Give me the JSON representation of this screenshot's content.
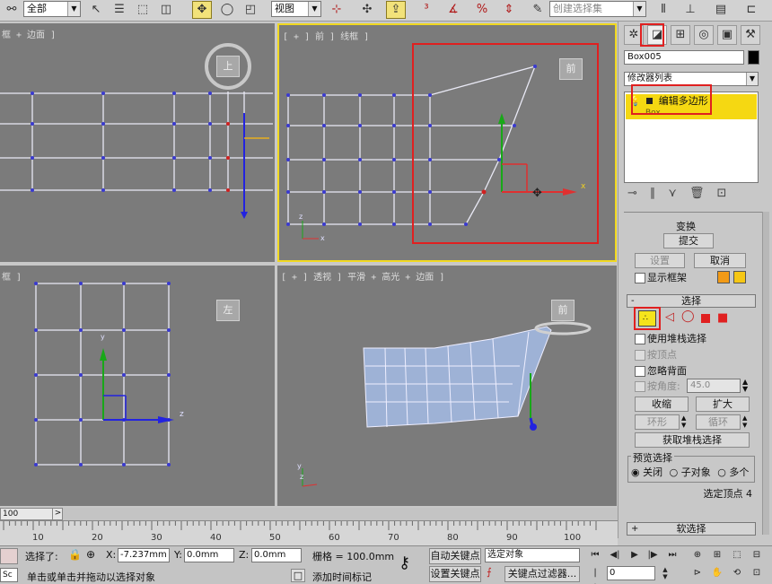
{
  "toolbar": {
    "selection_filter": "全部",
    "ref_coord": "视图",
    "named_selection": "创建选择集"
  },
  "viewports": {
    "top": {
      "label": "框 + 边面 ]",
      "cube": "上"
    },
    "front": {
      "label": "[ + ] 前 ] 线框 ]",
      "cube": "前",
      "axis_x": "x",
      "axis_z": "z",
      "gizmo_x": "x"
    },
    "left": {
      "label": "框 ]",
      "cube": "左",
      "axis_y": "y",
      "gizmo_z": "z"
    },
    "persp": {
      "label": "[ + ] 透视 ] 平滑 + 高光 + 边面 ]",
      "cube": "前",
      "axis_y": "y",
      "axis_z": "z"
    }
  },
  "command_panel": {
    "object_name": "Box005",
    "modifier_list": "修改器列表",
    "stack": [
      {
        "label": "编辑多边形",
        "selected": true
      },
      {
        "label": "Box",
        "selected": false
      }
    ],
    "rollout_top_label": "变换",
    "commit": "提交",
    "settings": "设置",
    "cancel": "取消",
    "show_cage": "显示框架",
    "selection_rollout": "选择",
    "use_stack_selection": "使用堆栈选择",
    "by_vertex": "按顶点",
    "ignore_backfacing": "忽略背面",
    "by_angle": "按角度:",
    "angle_value": "45.0",
    "shrink": "收缩",
    "grow": "扩大",
    "ring": "环形",
    "loop": "循环",
    "get_stack_selection": "获取堆栈选择",
    "preview_selection": "预览选择",
    "preview_off": "关闭",
    "preview_subobj": "子对象",
    "preview_multi": "多个",
    "selected_info": "选定顶点 4",
    "soft_selection": "软选择"
  },
  "timeline": {
    "slider": "100",
    "ticks": [
      "10",
      "20",
      "30",
      "40",
      "50",
      "60",
      "70",
      "80",
      "90",
      "100"
    ]
  },
  "status": {
    "selected_label": "选择了:",
    "x_label": "X:",
    "x_value": "-7.237mm",
    "y_label": "Y:",
    "y_value": "0.0mm",
    "z_label": "Z:",
    "z_value": "0.0mm",
    "grid": "栅格 = 100.0mm",
    "auto_key": "自动关键点",
    "set_key": "设置关键点",
    "selected_object": "选定对象",
    "key_filters": "关键点过滤器...",
    "frame": "0",
    "prompt": "单击或单击并拖动以选择对象",
    "add_time_tag": "添加时间标记",
    "maxscript": "Sc"
  }
}
